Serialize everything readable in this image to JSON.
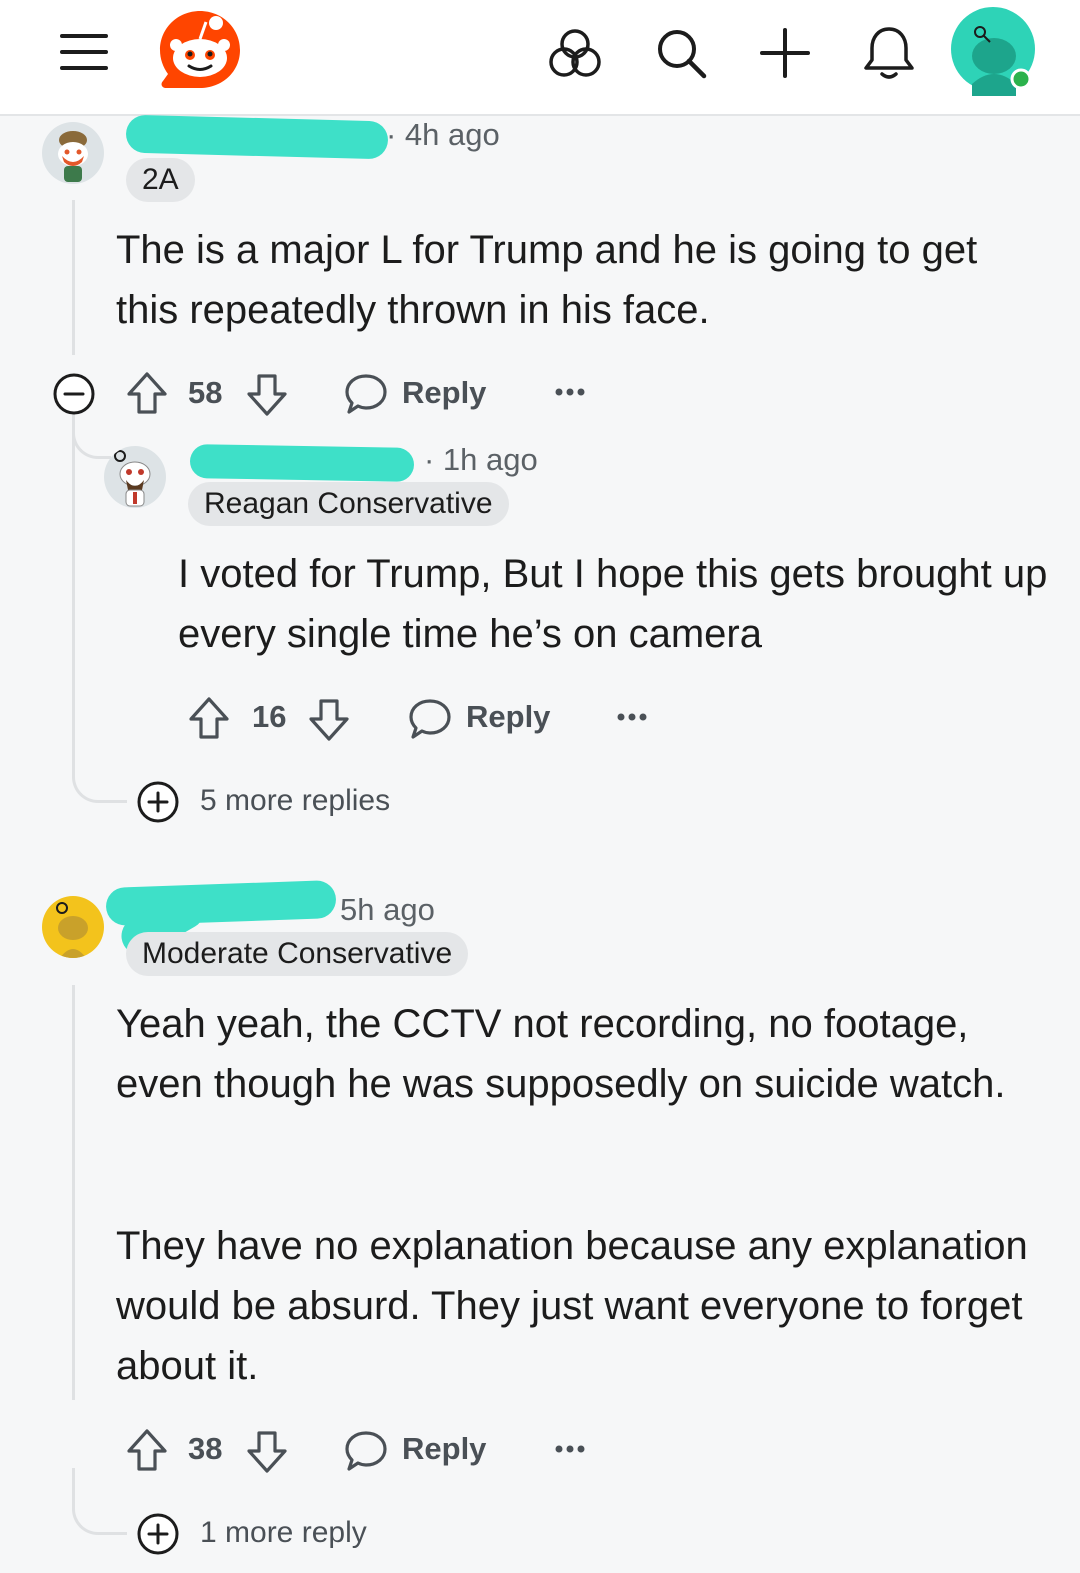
{
  "header": {
    "icons": [
      "menu-icon",
      "reddit-logo",
      "communities-icon",
      "search-icon",
      "create-icon",
      "notifications-icon",
      "user-avatar"
    ],
    "brand_color": "#ff4500",
    "avatar_color": "#2ed3b7",
    "online_color": "#2bb24c"
  },
  "comments": [
    {
      "time": "· 4h ago",
      "flair": "2A",
      "body": "The is a major L for Trump and he is going to get this repeatedly thrown in his face.",
      "upvotes": "58",
      "reply_label": "Reply"
    },
    {
      "time": "· 1h ago",
      "flair": "Reagan Conservative",
      "body": "I voted for Trump, But I hope this gets brought up every single time he’s on camera",
      "upvotes": "16",
      "reply_label": "Reply"
    },
    {
      "time": "5h ago",
      "flair": "Moderate Conservative",
      "body_p1": "Yeah yeah, the CCTV not recording, no footage, even though he was supposedly on suicide watch.",
      "body_p2": "They have no explanation because any explanation would be absurd. They just want everyone to forget about it.",
      "upvotes": "38",
      "reply_label": "Reply"
    }
  ],
  "more_replies": {
    "first": "5 more replies",
    "second": "1 more reply"
  },
  "redaction_color": "#3ee0c8"
}
